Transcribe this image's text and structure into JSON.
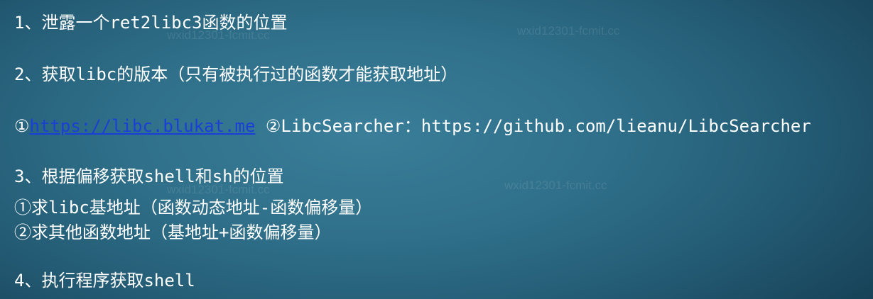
{
  "slide": {
    "line1": "1、泄露一个ret2libc3函数的位置",
    "line2": "2、获取libc的版本（只有被执行过的函数才能获取地址）",
    "line3": {
      "marker1": "①",
      "link_text": "https://libc.blukat.me",
      "rest": " ②LibcSearcher：https://github.com/lieanu/LibcSearcher"
    },
    "line4": "3、根据偏移获取shell和sh的位置",
    "line5": "①求libc基地址（函数动态地址-函数偏移量）",
    "line6": "②求其他函数地址（基地址+函数偏移量）",
    "line7": "4、执行程序获取shell"
  },
  "watermark": {
    "text_main": "wxid12301-fcmit.cc",
    "text_faint": "wxid12301-fcmit.cc"
  },
  "colors": {
    "text": "#ffffff",
    "link": "#1a3fd6",
    "background": "#2f6f89"
  }
}
